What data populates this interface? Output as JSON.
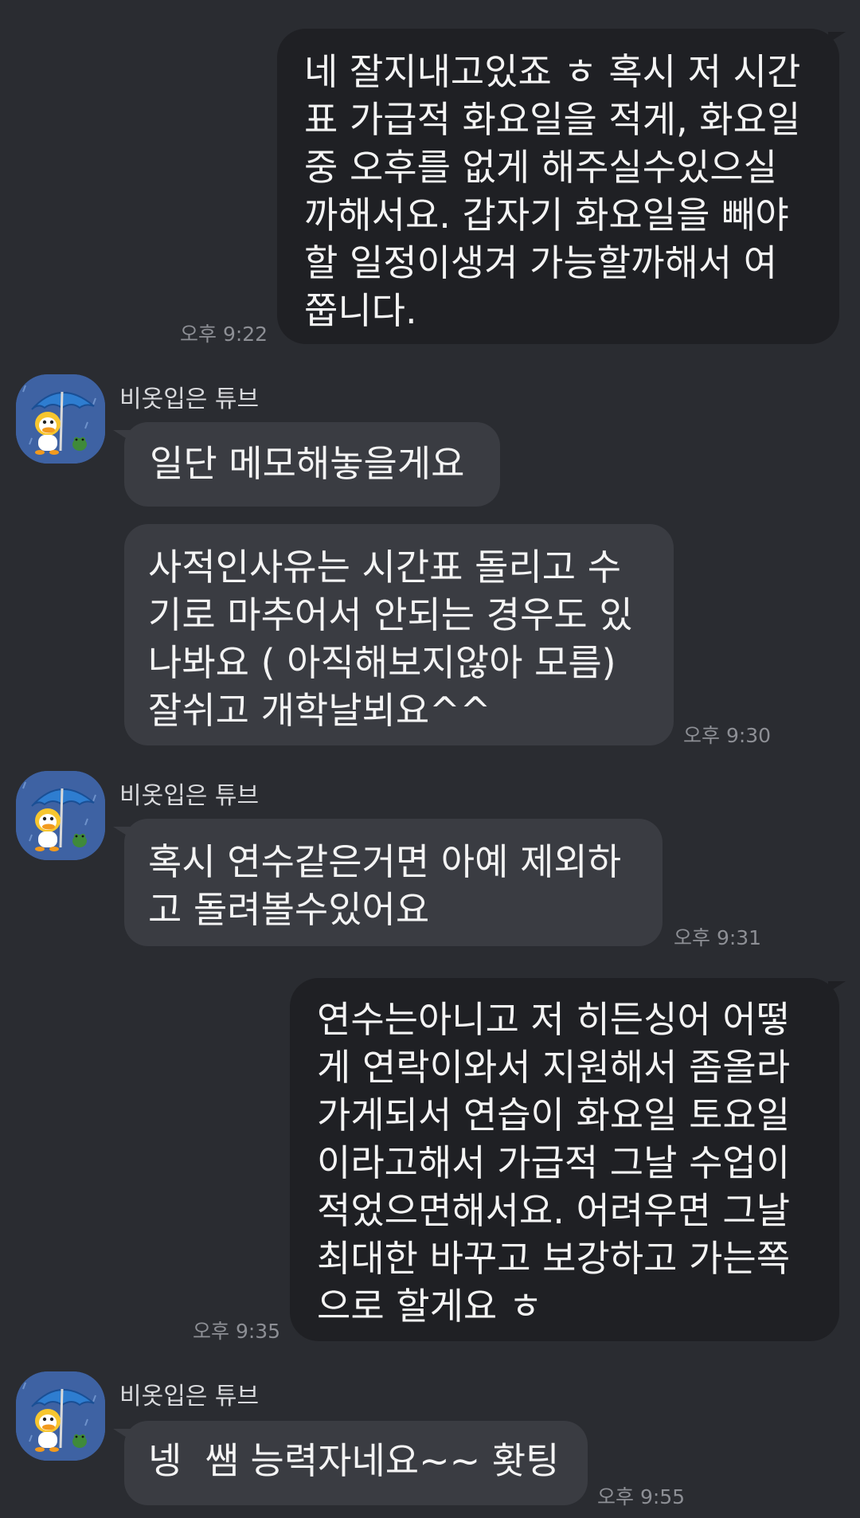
{
  "messages": [
    {
      "id": "m1",
      "direction": "sent",
      "text": "네 잘지내고있죠 ㅎ 혹시 저 시간\n표 가급적 화요일을 적게, 화요일\n중 오후를 없게 해주실수있으실\n까해서요. 갑자기 화요일을 빼야\n할 일정이생겨 가능할까해서 여\n쭙니다.",
      "time": "오후 9:22"
    },
    {
      "id": "m2",
      "direction": "received",
      "sender": "비옷입은 튜브",
      "text": "일단 메모해놓을게요"
    },
    {
      "id": "m3",
      "direction": "received",
      "text": "사적인사유는 시간표 돌리고 수\n기로 마추어서 안되는 경우도 있\n나봐요 ( 아직해보지않아 모름)\n잘쉬고 개학날뵈요^^",
      "time": "오후 9:30"
    },
    {
      "id": "m4",
      "direction": "received",
      "sender": "비옷입은 튜브",
      "text": "혹시 연수같은거면 아예 제외하\n고 돌려볼수있어요",
      "time": "오후 9:31"
    },
    {
      "id": "m5",
      "direction": "sent",
      "text": "연수는아니고 저 히든싱어 어떻\n게 연락이와서 지원해서 좀올라\n가게되서 연습이 화요일 토요일\n이라고해서 가급적 그날 수업이\n적었으면해서요. 어려우면 그날\n최대한 바꾸고 보강하고 가는쪽\n으로 할게요 ㅎ",
      "time": "오후 9:35"
    },
    {
      "id": "m6",
      "direction": "received",
      "sender": "비옷입은 튜브",
      "text": "넹  쌤 능력자네요~~ 홧팅",
      "time": "오후 9:55"
    }
  ],
  "avatar": {
    "icon": "tube-duck-umbrella-avatar",
    "colors": {
      "background": "#3e62a3",
      "umbrella": "#2e7dd0",
      "duck": "#f7c62f",
      "frog": "#3f8a3a"
    }
  },
  "colors": {
    "background": "#2a2c31",
    "sent_bubble": "#1f2024",
    "received_bubble": "#3a3c42",
    "timestamp": "#8d8f95",
    "text": "#f4f4f4"
  }
}
